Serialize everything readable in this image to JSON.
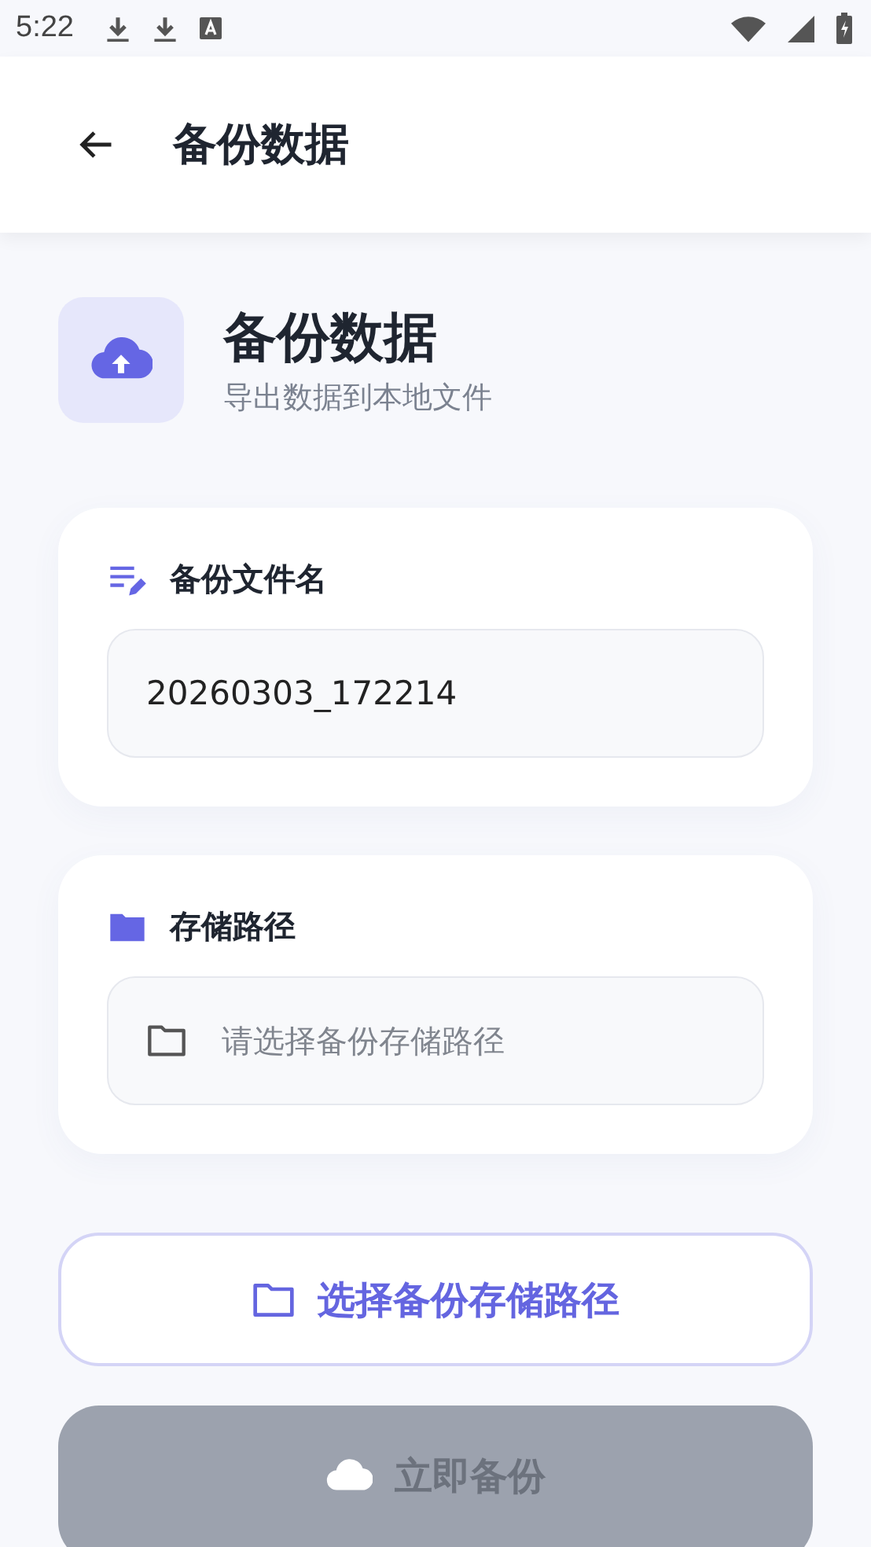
{
  "status_bar": {
    "time": "5:22"
  },
  "app_bar": {
    "title": "备份数据"
  },
  "header": {
    "title": "备份数据",
    "subtitle": "导出数据到本地文件"
  },
  "cards": [
    {
      "kind": "filename",
      "label": "备份文件名",
      "field": {
        "value": "20260303_172214"
      }
    },
    {
      "kind": "path",
      "label": "存储路径",
      "field": {
        "placeholder": "请选择备份存储路径"
      }
    }
  ],
  "buttons": [
    {
      "kind": "outline",
      "label": "选择备份存储路径"
    },
    {
      "kind": "primary",
      "label": "立即备份",
      "disabled": true
    }
  ]
}
